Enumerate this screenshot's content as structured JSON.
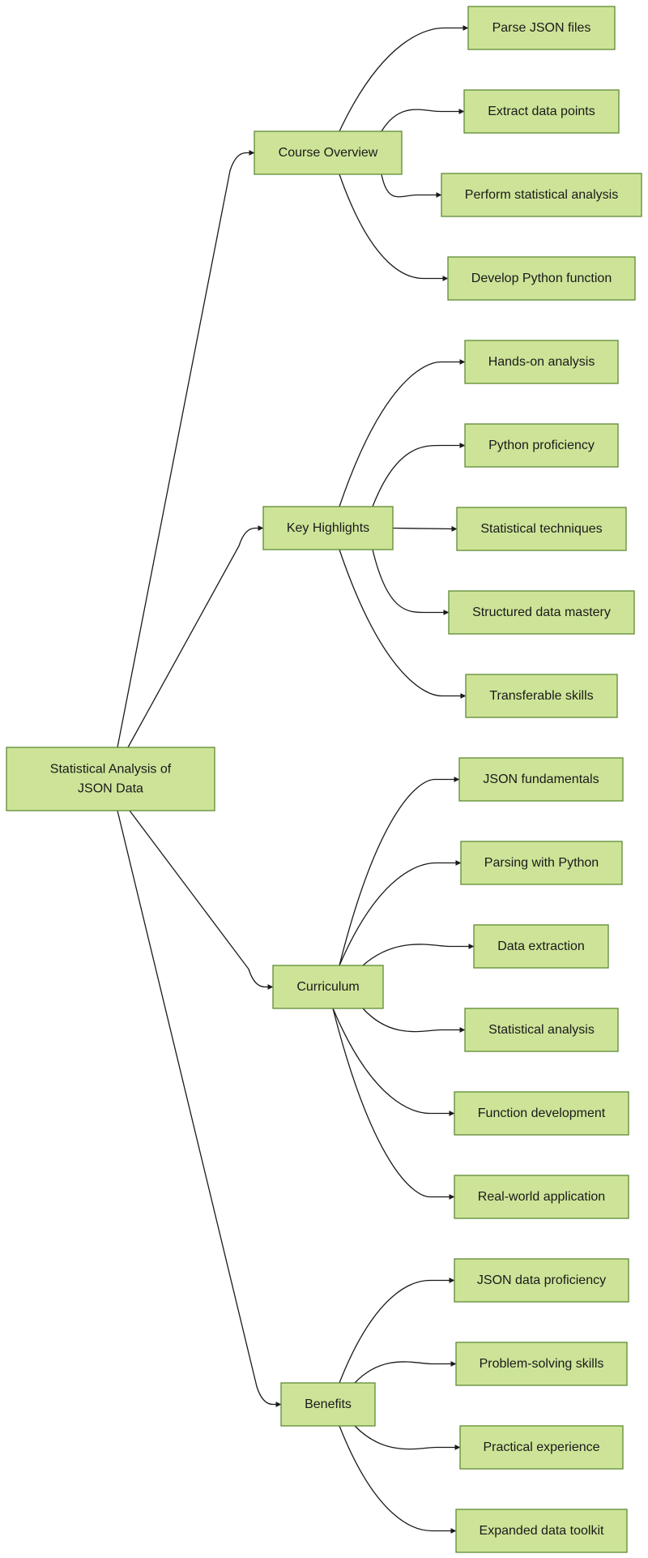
{
  "diagram": {
    "type": "mindmap-tree",
    "colors": {
      "node_fill": "#cde498",
      "node_border": "#5f8a34",
      "edge": "#1a1a1a",
      "text": "#1a1a1a",
      "background": "#ffffff"
    },
    "root": {
      "label_lines": [
        "Statistical Analysis of",
        "JSON Data"
      ]
    },
    "branches": [
      {
        "label": "Course Overview",
        "children": [
          "Parse JSON files",
          "Extract data points",
          "Perform statistical analysis",
          "Develop Python function"
        ]
      },
      {
        "label": "Key Highlights",
        "children": [
          "Hands-on analysis",
          "Python proficiency",
          "Statistical techniques",
          "Structured data mastery",
          "Transferable skills"
        ]
      },
      {
        "label": "Curriculum",
        "children": [
          "JSON fundamentals",
          "Parsing with Python",
          "Data extraction",
          "Statistical analysis",
          "Function development",
          "Real-world application"
        ]
      },
      {
        "label": "Benefits",
        "children": [
          "JSON data proficiency",
          "Problem-solving skills",
          "Practical experience",
          "Expanded data toolkit"
        ]
      }
    ]
  }
}
